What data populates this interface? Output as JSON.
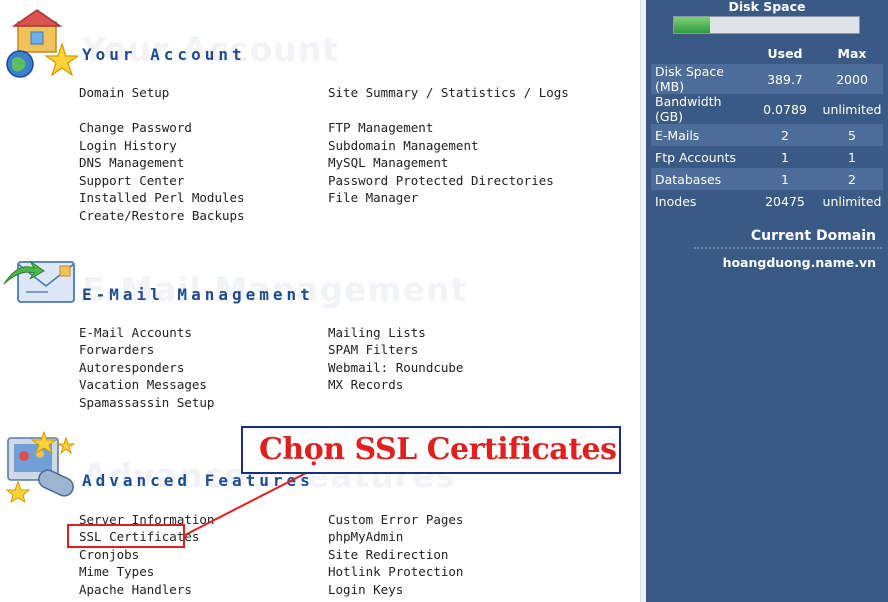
{
  "sections": [
    {
      "title": "Your Account",
      "icon": "house-icon",
      "links_left": [
        "Domain Setup",
        "Change Password",
        "Login History",
        "DNS Management",
        "Support Center",
        "Installed Perl Modules",
        "Create/Restore Backups"
      ],
      "links_right": [
        "Site Summary / Statistics / Logs",
        "FTP Management",
        "Subdomain Management",
        "MySQL Management",
        "Password Protected Directories",
        "File Manager"
      ]
    },
    {
      "title": "E-Mail Management",
      "icon": "envelope-icon",
      "links_left": [
        "E-Mail Accounts",
        "Forwarders",
        "Autoresponders",
        "Vacation Messages",
        "Spamassassin Setup"
      ],
      "links_right": [
        "Mailing Lists",
        "SPAM Filters",
        "Webmail: Roundcube",
        "MX Records"
      ]
    },
    {
      "title": "Advanced Features",
      "icon": "advanced-tools-icon",
      "links_left": [
        "Server Information",
        "SSL Certificates",
        "Cronjobs",
        "Mime Types",
        "Apache Handlers"
      ],
      "links_right": [
        "Custom Error Pages",
        "phpMyAdmin",
        "Site Redirection",
        "Hotlink Protection",
        "Login Keys"
      ]
    }
  ],
  "sidebar": {
    "disk_space_title": "Disk Space",
    "disk_usage_fraction": 0.195,
    "col_used": "Used",
    "col_max": "Max",
    "stats": [
      {
        "label": "Disk Space (MB)",
        "used": "389.7",
        "max": "2000"
      },
      {
        "label": "Bandwidth (GB)",
        "used": "0.0789",
        "max": "unlimited"
      },
      {
        "label": "E-Mails",
        "used": "2",
        "max": "5"
      },
      {
        "label": "Ftp Accounts",
        "used": "1",
        "max": "1"
      },
      {
        "label": "Databases",
        "used": "1",
        "max": "2"
      },
      {
        "label": "Inodes",
        "used": "20475",
        "max": "unlimited"
      }
    ],
    "current_domain_title": "Current Domain",
    "current_domain": "hoangduong.name.vn"
  },
  "annotation": {
    "text": "Chọn SSL Certificates",
    "highlighted_link": "SSL Certificates"
  },
  "colors": {
    "sidebar_bg": "#3a5a86",
    "section_title": "#1f4c8f",
    "annotation_red": "#e01f1f",
    "annotation_border": "#1b2f7a"
  }
}
